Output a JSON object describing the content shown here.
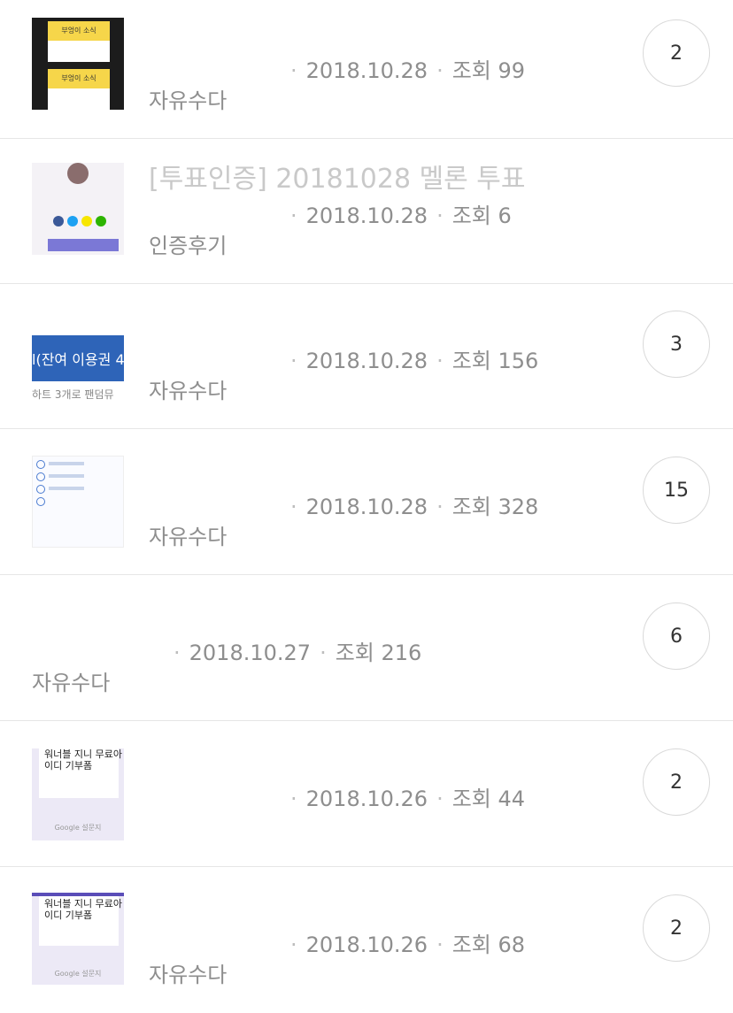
{
  "posts": [
    {
      "title": "",
      "author": "",
      "date": "2018.10.28",
      "views_label": "조회 99",
      "category": "자유수다",
      "comments": "2",
      "thumb_text": [
        "부엉이 소식",
        "부엉이 소식"
      ]
    },
    {
      "title": "[투표인증] 20181028 멜론 투표",
      "author": "",
      "date": "2018.10.28",
      "views_label": "조회 6",
      "category": "인증후기",
      "comments": ""
    },
    {
      "title": "",
      "author": "",
      "date": "2018.10.28",
      "views_label": "조회 156",
      "category": "자유수다",
      "comments": "3",
      "thumb_text": [
        "l(잔여 이용권 4",
        "하트 3개로 팬덤뮤"
      ]
    },
    {
      "title": "",
      "author": "",
      "date": "2018.10.28",
      "views_label": "조회 328",
      "category": "자유수다",
      "comments": "15"
    },
    {
      "title": "",
      "author": "",
      "date": "2018.10.27",
      "views_label": "조회 216",
      "category": "자유수다",
      "comments": "6"
    },
    {
      "title": "",
      "author": "",
      "date": "2018.10.26",
      "views_label": "조회 44",
      "category": "",
      "comments": "2",
      "thumb_text": [
        "워너블 지니 무료아",
        "이디 기부폼",
        "Google 설문지"
      ]
    },
    {
      "title": "",
      "author": "",
      "date": "2018.10.26",
      "views_label": "조회 68",
      "category": "자유수다",
      "comments": "2",
      "thumb_text": [
        "워너블 지니 무료아",
        "이디 기부폼",
        "Google 설문지"
      ]
    }
  ],
  "colors": {
    "badge_border": "#d9d9d9",
    "meta_text": "#8e8e8e",
    "divider": "#e6e6e6",
    "thumb_blue": "#2e64b8"
  },
  "icons": [
    "comment-count-badge"
  ]
}
